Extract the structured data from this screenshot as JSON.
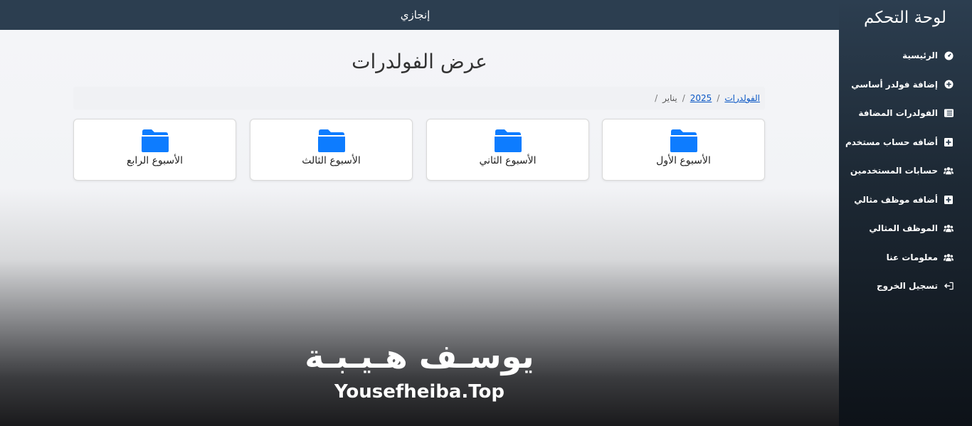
{
  "sidebar": {
    "title": "لوحة التحكم",
    "items": [
      {
        "label": "الرئيسية",
        "icon": "dashboard-icon"
      },
      {
        "label": "إضافة فولدر أساسي",
        "icon": "plus-circle-icon"
      },
      {
        "label": "الفولدرات المضافة",
        "icon": "list-icon"
      },
      {
        "label": "أضافه حساب مستخدم",
        "icon": "plus-square-icon"
      },
      {
        "label": "حسابات المستخدمين",
        "icon": "users-icon"
      },
      {
        "label": "أضافه موظف مثالي",
        "icon": "plus-square-icon"
      },
      {
        "label": "الموظف المثالي",
        "icon": "users-icon"
      },
      {
        "label": "معلومات عنا",
        "icon": "users-icon"
      },
      {
        "label": "تسجيل الخروج",
        "icon": "logout-icon"
      }
    ]
  },
  "topbar": {
    "brand": "إنجازي"
  },
  "page": {
    "title": "عرض الفولدرات",
    "breadcrumb": [
      "الفولدرات",
      "2025",
      "يناير"
    ]
  },
  "folders": [
    {
      "label": "الأسبوع الأول"
    },
    {
      "label": "الأسبوع الثاني"
    },
    {
      "label": "الأسبوع الثالث"
    },
    {
      "label": "الأسبوع الرابع"
    }
  ],
  "watermark": {
    "arabic": "يوسـف هـيـبـة",
    "latin": "Yousefheiba.Top"
  },
  "colors": {
    "sidebar": "#2c3e50",
    "folder": "#0d7cff",
    "link": "#0a57c5"
  }
}
